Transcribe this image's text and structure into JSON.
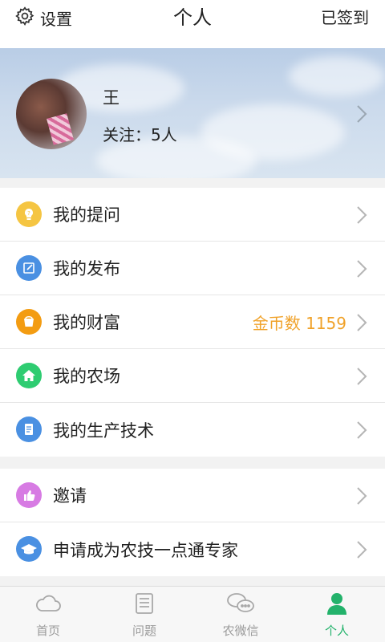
{
  "topbar": {
    "settings_label": "设置",
    "title": "个人",
    "checkin_label": "已签到"
  },
  "profile": {
    "name": "王",
    "follow_label": "关注：",
    "follow_count": "5人"
  },
  "menu_main": [
    {
      "label": "我的提问",
      "icon": "question-bulb-icon",
      "color": "#f5c542"
    },
    {
      "label": "我的发布",
      "icon": "edit-icon",
      "color": "#4a90e2"
    },
    {
      "label": "我的财富",
      "icon": "wealth-icon",
      "color": "#f39c12",
      "extra": "金币数 1159"
    },
    {
      "label": "我的农场",
      "icon": "home-icon",
      "color": "#2ecc71"
    },
    {
      "label": "我的生产技术",
      "icon": "document-icon",
      "color": "#4a90e2"
    }
  ],
  "menu_secondary": [
    {
      "label": "邀请",
      "icon": "thumbs-up-icon",
      "color": "#d77be3"
    },
    {
      "label": "申请成为农技一点通专家",
      "icon": "graduation-cap-icon",
      "color": "#4a90e2"
    }
  ],
  "bottomnav": [
    {
      "label": "首页",
      "icon": "cloud-icon"
    },
    {
      "label": "问题",
      "icon": "list-icon"
    },
    {
      "label": "农微信",
      "icon": "chat-bubbles-icon"
    },
    {
      "label": "个人",
      "icon": "person-icon",
      "active": true
    }
  ],
  "colors": {
    "accent_green": "#23b26b",
    "coins_orange": "#f0a22a"
  }
}
